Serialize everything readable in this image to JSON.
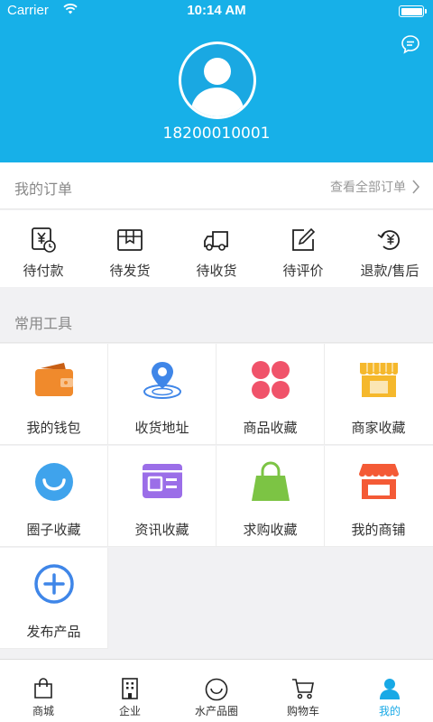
{
  "status_bar": {
    "carrier": "Carrier",
    "time": "10:14 AM"
  },
  "profile": {
    "phone": "18200010001"
  },
  "orders": {
    "title": "我的订单",
    "view_all": "查看全部订单",
    "items": [
      {
        "label": "待付款",
        "icon": "yuan-clock-icon"
      },
      {
        "label": "待发货",
        "icon": "package-icon"
      },
      {
        "label": "待收货",
        "icon": "truck-icon"
      },
      {
        "label": "待评价",
        "icon": "edit-review-icon"
      },
      {
        "label": "退款/售后",
        "icon": "refund-icon"
      }
    ]
  },
  "tools": {
    "title": "常用工具",
    "items": [
      {
        "label": "我的钱包",
        "icon": "wallet-icon",
        "color": "#f08a2c"
      },
      {
        "label": "收货地址",
        "icon": "location-icon",
        "color": "#3f86e8"
      },
      {
        "label": "商品收藏",
        "icon": "clover-icon",
        "color": "#f0536a"
      },
      {
        "label": "商家收藏",
        "icon": "shop-awning-icon",
        "color": "#f5b82c"
      },
      {
        "label": "圈子收藏",
        "icon": "smile-circle-icon",
        "color": "#3fa3ec"
      },
      {
        "label": "资讯收藏",
        "icon": "news-card-icon",
        "color": "#9b6ee8"
      },
      {
        "label": "求购收藏",
        "icon": "shopping-bag-icon",
        "color": "#7cc444"
      },
      {
        "label": "我的商铺",
        "icon": "store-icon",
        "color": "#f45a36"
      },
      {
        "label": "发布产品",
        "icon": "add-circle-icon",
        "color": "#3f86e8"
      }
    ]
  },
  "tabbar": {
    "items": [
      {
        "label": "商城",
        "icon": "bag-icon",
        "active": false
      },
      {
        "label": "企业",
        "icon": "building-icon",
        "active": false
      },
      {
        "label": "水产品圈",
        "icon": "smile-icon",
        "active": false
      },
      {
        "label": "购物车",
        "icon": "cart-icon",
        "active": false
      },
      {
        "label": "我的",
        "icon": "user-icon",
        "active": true
      }
    ]
  },
  "colors": {
    "header": "#17b0e8",
    "accent": "#18a9e6"
  }
}
